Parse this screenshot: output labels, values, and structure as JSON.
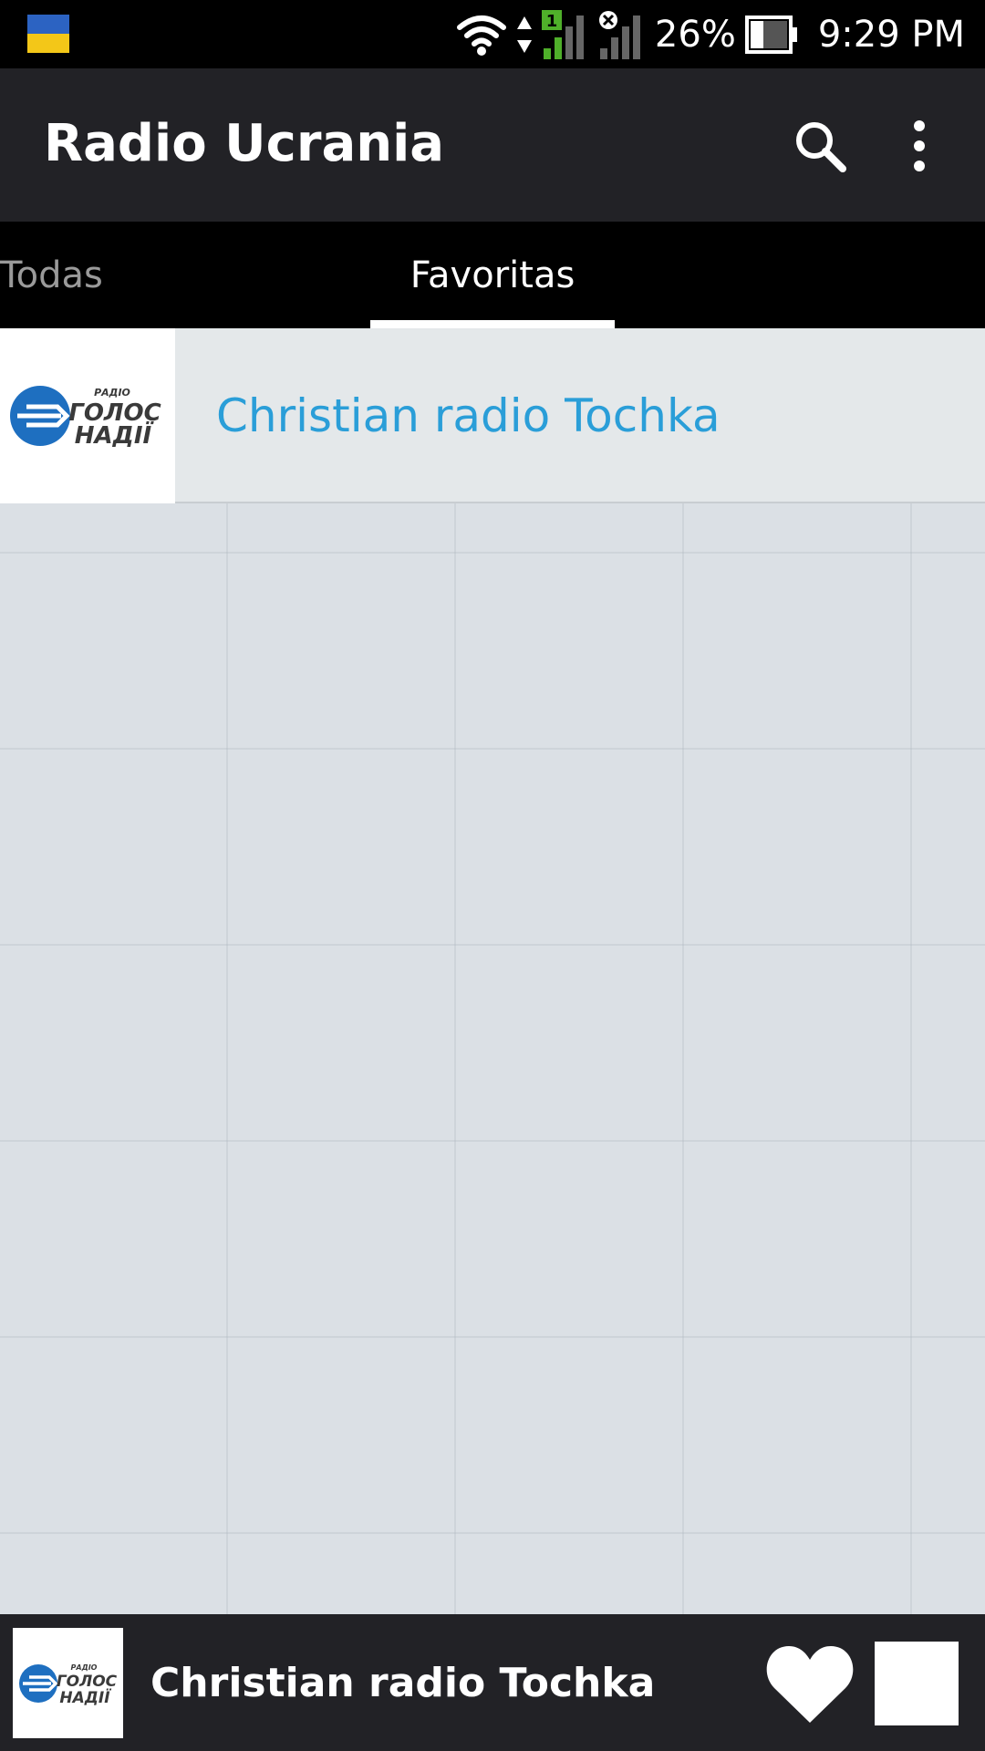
{
  "status_bar": {
    "battery": "26%",
    "time": "9:29 PM",
    "sim_indicator": "1"
  },
  "app_bar": {
    "title": "Radio Ucrania",
    "search_icon": "search-icon",
    "more_icon": "more-vert-icon"
  },
  "tabs": [
    {
      "label": "Todas",
      "selected": false
    },
    {
      "label": "Favoritas",
      "selected": true
    }
  ],
  "favorites": [
    {
      "name": "Christian radio Tochka",
      "logo_lines": [
        "РАДІО",
        "ГОЛОС",
        "НАДІЇ"
      ]
    }
  ],
  "player": {
    "station": "Christian radio Tochka",
    "logo_lines": [
      "РАДІО",
      "ГОЛОС",
      "НАДІЇ"
    ],
    "favorite_icon": "heart-icon",
    "stop_icon": "stop-icon"
  },
  "colors": {
    "app_bar": "#222226",
    "tabs_bg": "#000000",
    "accent_text": "#2a9ed8",
    "logo_blue": "#1e6fc0"
  }
}
